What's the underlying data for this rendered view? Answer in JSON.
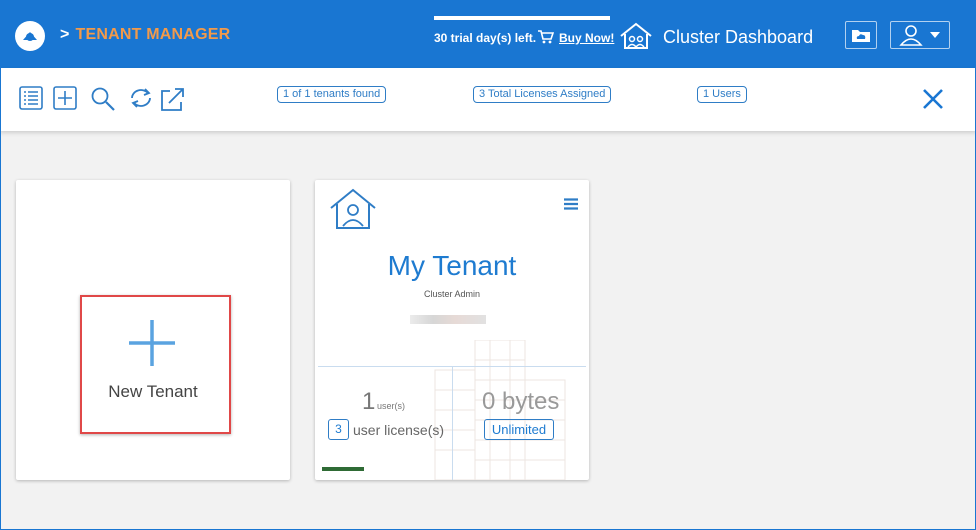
{
  "header": {
    "breadcrumb_sep": ">",
    "app_title": "TENANT MANAGER",
    "trial_text": "30 trial day(s) left.",
    "buy_label": "Buy Now!",
    "cluster_title": "Cluster Dashboard",
    "colors": {
      "bar": "#1976d2",
      "title_accent": "#f29a4a"
    }
  },
  "toolbar": {
    "icons": [
      "list-view-icon",
      "add-icon",
      "search-icon",
      "refresh-icon",
      "export-icon"
    ],
    "tenants_found": "1 of 1 tenants found",
    "licenses_assigned": "3 Total Licenses Assigned",
    "users": "1 Users",
    "close_icon": "close-icon"
  },
  "new_tenant": {
    "label": "New Tenant"
  },
  "tenant": {
    "name": "My Tenant",
    "role": "Cluster Admin",
    "users_count": "1",
    "users_unit": "user(s)",
    "license_count": "3",
    "license_label": "user license(s)",
    "storage": "0 bytes",
    "quota": "Unlimited"
  }
}
